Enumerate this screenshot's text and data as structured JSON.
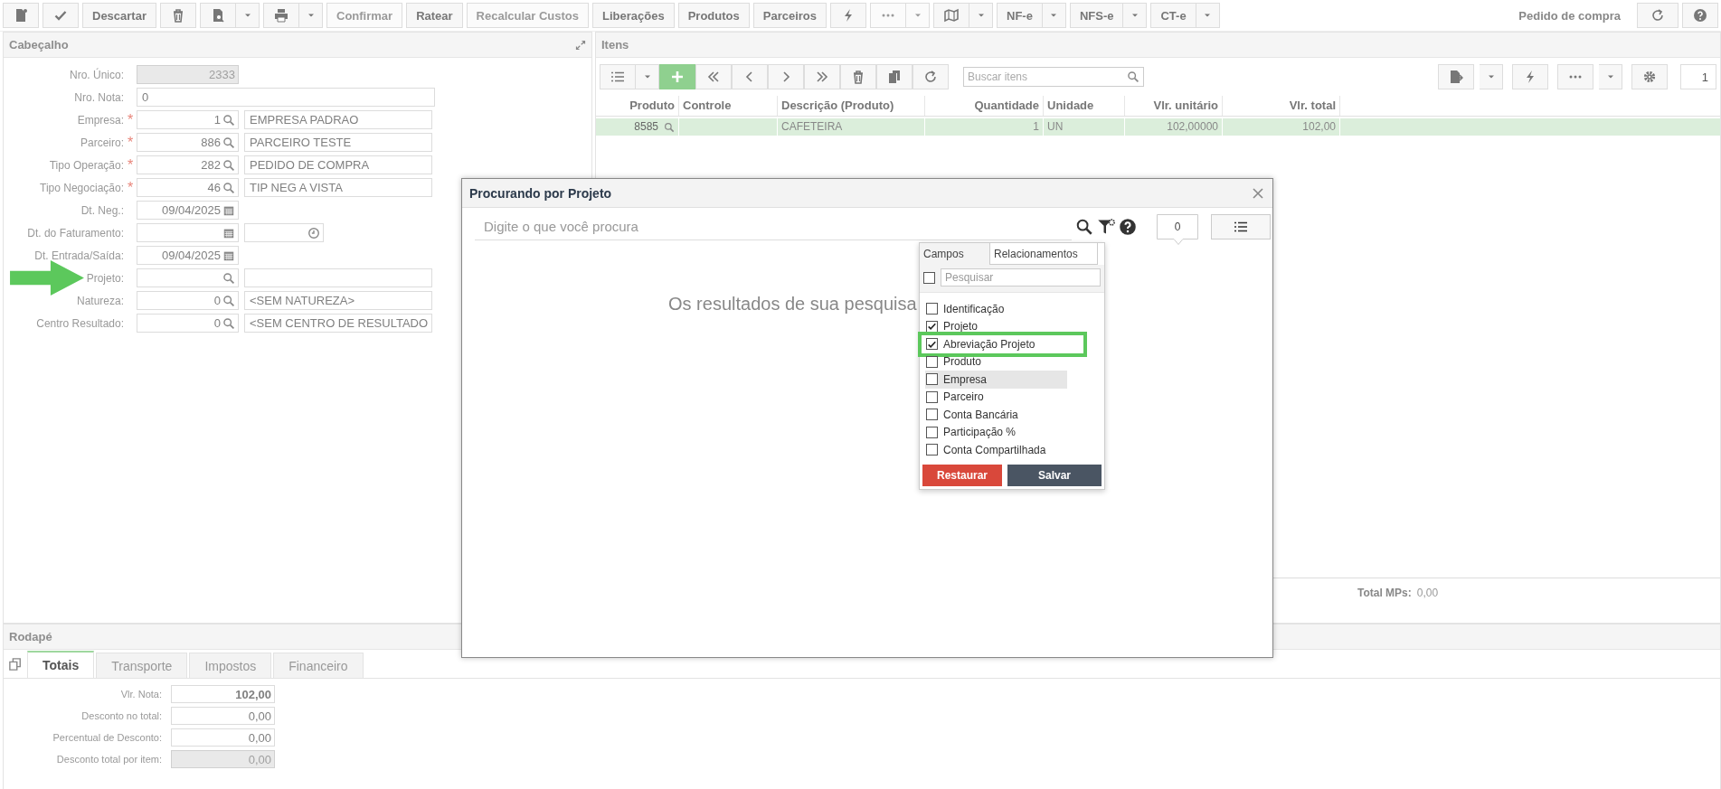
{
  "toolbar": {
    "buttons": [
      {
        "kind": "icon",
        "disabled": false,
        "caret": false
      },
      {
        "kind": "icon",
        "disabled": false,
        "caret": false
      },
      {
        "kind": "text",
        "label": "Descartar",
        "disabled": false,
        "caret": false
      },
      {
        "kind": "icon",
        "disabled": false,
        "caret": false
      },
      {
        "kind": "icon",
        "disabled": false,
        "caret": true
      },
      {
        "kind": "icon",
        "disabled": false,
        "caret": true
      },
      {
        "kind": "text",
        "label": "Confirmar",
        "disabled": true,
        "caret": false
      },
      {
        "kind": "text",
        "label": "Ratear",
        "disabled": false,
        "caret": false
      },
      {
        "kind": "text",
        "label": "Recalcular Custos",
        "disabled": true,
        "caret": false
      },
      {
        "kind": "text",
        "label": "Liberações",
        "disabled": false,
        "caret": false
      },
      {
        "kind": "text",
        "label": "Produtos",
        "disabled": false,
        "caret": false
      },
      {
        "kind": "text",
        "label": "Parceiros",
        "disabled": false,
        "caret": false
      },
      {
        "kind": "icon",
        "disabled": false,
        "caret": false
      },
      {
        "kind": "icon",
        "disabled": true,
        "caret": true
      },
      {
        "kind": "icon",
        "disabled": false,
        "caret": true
      },
      {
        "kind": "text",
        "label": "NF-e",
        "disabled": false,
        "caret": true
      },
      {
        "kind": "text",
        "label": "NFS-e",
        "disabled": false,
        "caret": true
      },
      {
        "kind": "text",
        "label": "CT-e",
        "disabled": false,
        "caret": true
      }
    ],
    "title": "Pedido de compra"
  },
  "header_panel": {
    "title": "Cabeçalho",
    "fields": [
      {
        "label": "Nro. Único:",
        "kind": "readonly",
        "arrow": false,
        "value": "2333"
      },
      {
        "label": "Nro. Nota:",
        "kind": "text",
        "arrow": false,
        "value": "0"
      },
      {
        "label": "Empresa:",
        "kind": "lookup",
        "required_mark": "*",
        "arrow": false,
        "value": "1",
        "description": "EMPRESA PADRAO"
      },
      {
        "label": "Parceiro:",
        "kind": "lookup",
        "required_mark": "*",
        "arrow": false,
        "value": "886",
        "description": "PARCEIRO TESTE"
      },
      {
        "label": "Tipo Operação:",
        "kind": "lookup",
        "required_mark": "*",
        "arrow": false,
        "value": "282",
        "description": "PEDIDO DE COMPRA"
      },
      {
        "label": "Tipo Negociação:",
        "kind": "lookup",
        "required_mark": "*",
        "arrow": false,
        "value": "46",
        "description": "TIP NEG A VISTA"
      },
      {
        "label": "Dt. Neg.:",
        "kind": "date",
        "arrow": false,
        "value": "09/04/2025"
      },
      {
        "label": "Dt. do Faturamento:",
        "kind": "datetime",
        "arrow": false
      },
      {
        "label": "Dt. Entrada/Saída:",
        "kind": "date",
        "arrow": false,
        "value": "09/04/2025"
      },
      {
        "label": "Projeto:",
        "kind": "lookup",
        "arrow": true
      },
      {
        "label": "Natureza:",
        "kind": "lookup",
        "arrow": false,
        "value": "0",
        "description": "<SEM NATUREZA>"
      },
      {
        "label": "Centro Resultado:",
        "kind": "lookup",
        "arrow": false,
        "value": "0",
        "description": "<SEM CENTRO DE RESULTADO"
      }
    ]
  },
  "items_panel": {
    "title": "Itens",
    "search": {
      "placeholder": "Buscar itens"
    },
    "page": "1",
    "columns": [
      "Produto",
      "Controle",
      "Descrição (Produto)",
      "Quantidade",
      "Unidade",
      "Vlr. unitário",
      "Vlr. total"
    ],
    "rows": [
      {
        "selected": true,
        "cells": [
          "8585",
          "",
          "CAFETEIRA",
          "1",
          "UN",
          "102,00000",
          "102,00"
        ]
      }
    ],
    "total_label": "Total MPs:",
    "total_value": "0,00"
  },
  "footer_panel": {
    "title": "Rodapé",
    "tabs": [
      {
        "label": "Totais",
        "selected": true
      },
      {
        "label": "Transporte",
        "selected": false
      },
      {
        "label": "Impostos",
        "selected": false
      },
      {
        "label": "Financeiro",
        "selected": false
      }
    ],
    "fields": [
      {
        "label": "Vlr. Nota:",
        "value": "102,00",
        "bold": true,
        "readonly": false
      },
      {
        "label": "Desconto no total:",
        "value": "0,00",
        "bold": false,
        "readonly": false
      },
      {
        "label": "Percentual de Desconto:",
        "value": "0,00",
        "bold": false,
        "readonly": false
      },
      {
        "label": "Desconto total por item:",
        "value": "0,00",
        "bold": false,
        "readonly": true
      }
    ]
  },
  "dialog": {
    "title": "Procurando por Projeto",
    "search": {
      "placeholder": "Digite o que você procura"
    },
    "count": "0",
    "empty_message": "Os resultados de sua pesquisa",
    "columns_menu": {
      "tabs": [
        {
          "label": "Campos",
          "selected": true
        },
        {
          "label": "Relacionamentos",
          "selected": false
        }
      ],
      "search": {
        "placeholder": "Pesquisar",
        "checked": false
      },
      "fields": [
        {
          "label": "Identificação",
          "checked": false,
          "hovered": false,
          "highlighted": false
        },
        {
          "label": "Projeto",
          "checked": true,
          "hovered": false,
          "highlighted": false
        },
        {
          "label": "Abreviação Projeto",
          "checked": true,
          "hovered": false,
          "highlighted": true
        },
        {
          "label": "Produto",
          "checked": false,
          "hovered": false,
          "highlighted": false
        },
        {
          "label": "Empresa",
          "checked": false,
          "hovered": true,
          "highlighted": false
        },
        {
          "label": "Parceiro",
          "checked": false,
          "hovered": false,
          "highlighted": false
        },
        {
          "label": "Conta Bancária",
          "checked": false,
          "hovered": false,
          "highlighted": false
        },
        {
          "label": "Participação %",
          "checked": false,
          "hovered": false,
          "highlighted": false
        },
        {
          "label": "Conta Compartilhada",
          "checked": false,
          "hovered": false,
          "highlighted": false
        }
      ],
      "buttons": [
        {
          "label": "Restaurar",
          "kind": "danger"
        },
        {
          "label": "Salvar",
          "kind": "primary"
        }
      ]
    }
  }
}
